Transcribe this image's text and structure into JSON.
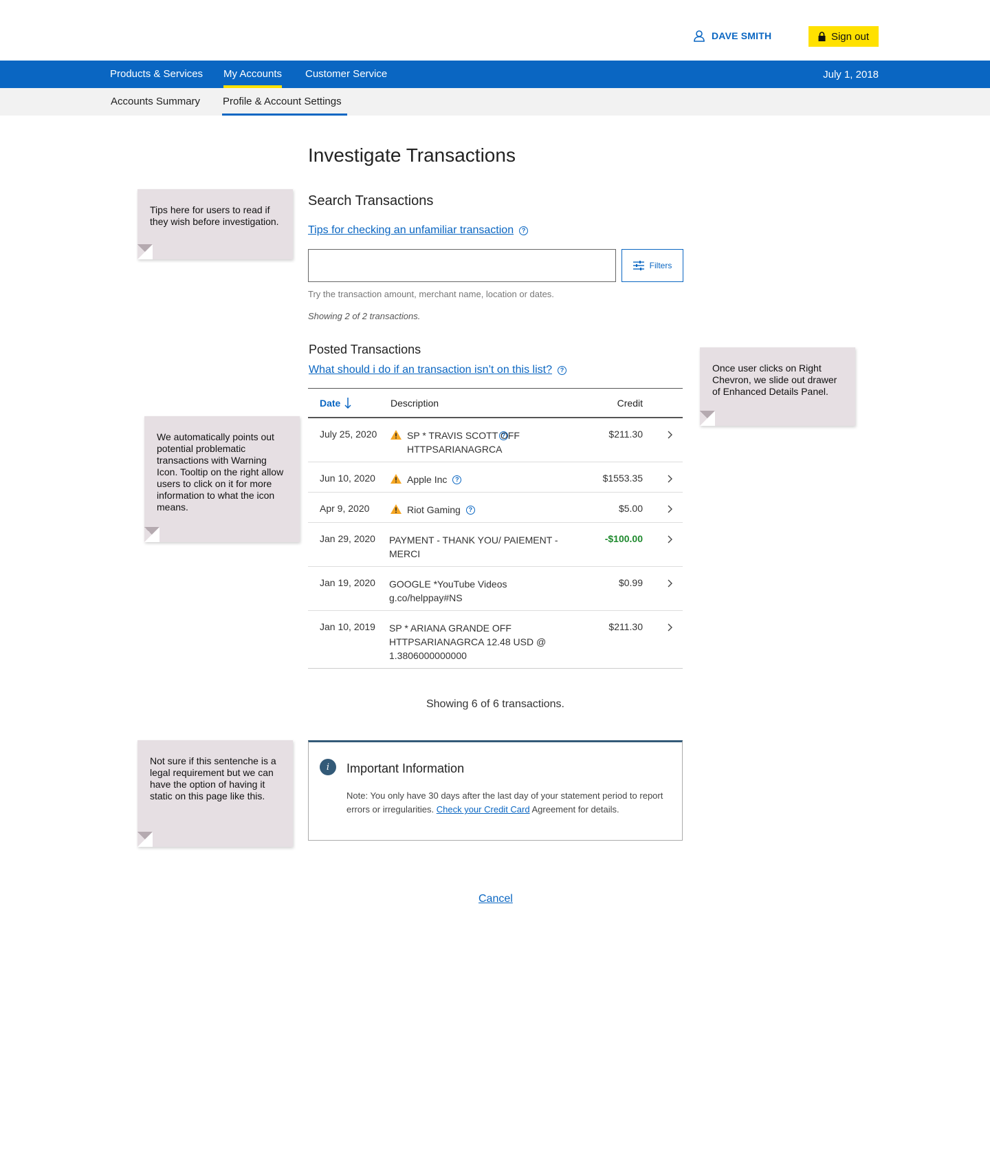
{
  "header": {
    "user_name": "DAVE SMITH",
    "signout_label": "Sign out"
  },
  "main_nav": {
    "items": [
      {
        "label": "Products & Services"
      },
      {
        "label": "My Accounts"
      },
      {
        "label": "Customer Service"
      }
    ],
    "date": "July 1, 2018"
  },
  "sub_nav": {
    "items": [
      {
        "label": "Accounts Summary"
      },
      {
        "label": "Profile & Account Settings"
      }
    ]
  },
  "page": {
    "title": "Investigate Transactions",
    "search_title": "Search Transactions",
    "tips_link": "Tips for checking an unfamiliar transaction",
    "search_value": "",
    "filters_label": "Filters",
    "hint": "Try the transaction amount, merchant name, location or dates.",
    "showing_top": "Showing 2 of 2 transactions.",
    "posted_title": "Posted Transactions",
    "posted_link": "What should i do if an transaction isn’t on this list?",
    "showing_bottom": "Showing 6 of 6 transactions.",
    "cancel": "Cancel"
  },
  "table": {
    "headers": {
      "date": "Date",
      "description": "Description",
      "credit": "Credit"
    },
    "rows": [
      {
        "date": "July 25, 2020",
        "description": "SP * TRAVIS SCOTT OFF HTTPSARIANAGRCA",
        "credit": "$211.30",
        "warning": true
      },
      {
        "date": "Jun 10, 2020",
        "description": "Apple Inc",
        "credit": "$1553.35",
        "warning": true
      },
      {
        "date": "Apr 9, 2020",
        "description": "Riot Gaming",
        "credit": "$5.00",
        "warning": true
      },
      {
        "date": "Jan 29, 2020",
        "description": "PAYMENT - THANK YOU/ PAIEMENT - MERCI",
        "credit": "-$100.00",
        "warning": false
      },
      {
        "date": "Jan 19, 2020",
        "description": "GOOGLE *YouTube Videos g.co/helppay#NS",
        "credit": "$0.99",
        "warning": false
      },
      {
        "date": "Jan 10, 2019",
        "description": "SP * ARIANA GRANDE OFF HTTPSARIANAGRCA 12.48 USD @ 1.3806000000000",
        "credit": "$211.30",
        "warning": false
      }
    ]
  },
  "info": {
    "icon_letter": "i",
    "title": "Important Information",
    "text_before": "Note: You only have 30 days after the last day of your statement period to report errors or irregularities. ",
    "link": "Check your Credit Card",
    "text_after": " Agreement for details."
  },
  "notes": [
    "Tips here for users to read if they wish before investigation.",
    "Once user clicks on Right Chevron, we slide out drawer of Enhanced Details Panel.",
    "We automatically points out potential problematic transactions with Warning Icon. Tooltip on the right allow users to click on it for more information to what the icon means.",
    "Not sure if this sentenche is a legal requirement but we can have the option of having it static on this page like this."
  ],
  "colors": {
    "brand_blue": "#0a66c2",
    "accent_yellow": "#ffe100",
    "success_green": "#1f8a2e",
    "info_navy": "#335a78",
    "warning_orange": "#f5a623"
  },
  "icons": {
    "user": "user-icon",
    "lock": "lock-icon",
    "filters": "sliders-icon",
    "help": "help-circle-icon",
    "warning": "warning-icon",
    "chevron": "chevron-right-icon",
    "sort": "arrow-down-icon",
    "info": "info-icon"
  }
}
